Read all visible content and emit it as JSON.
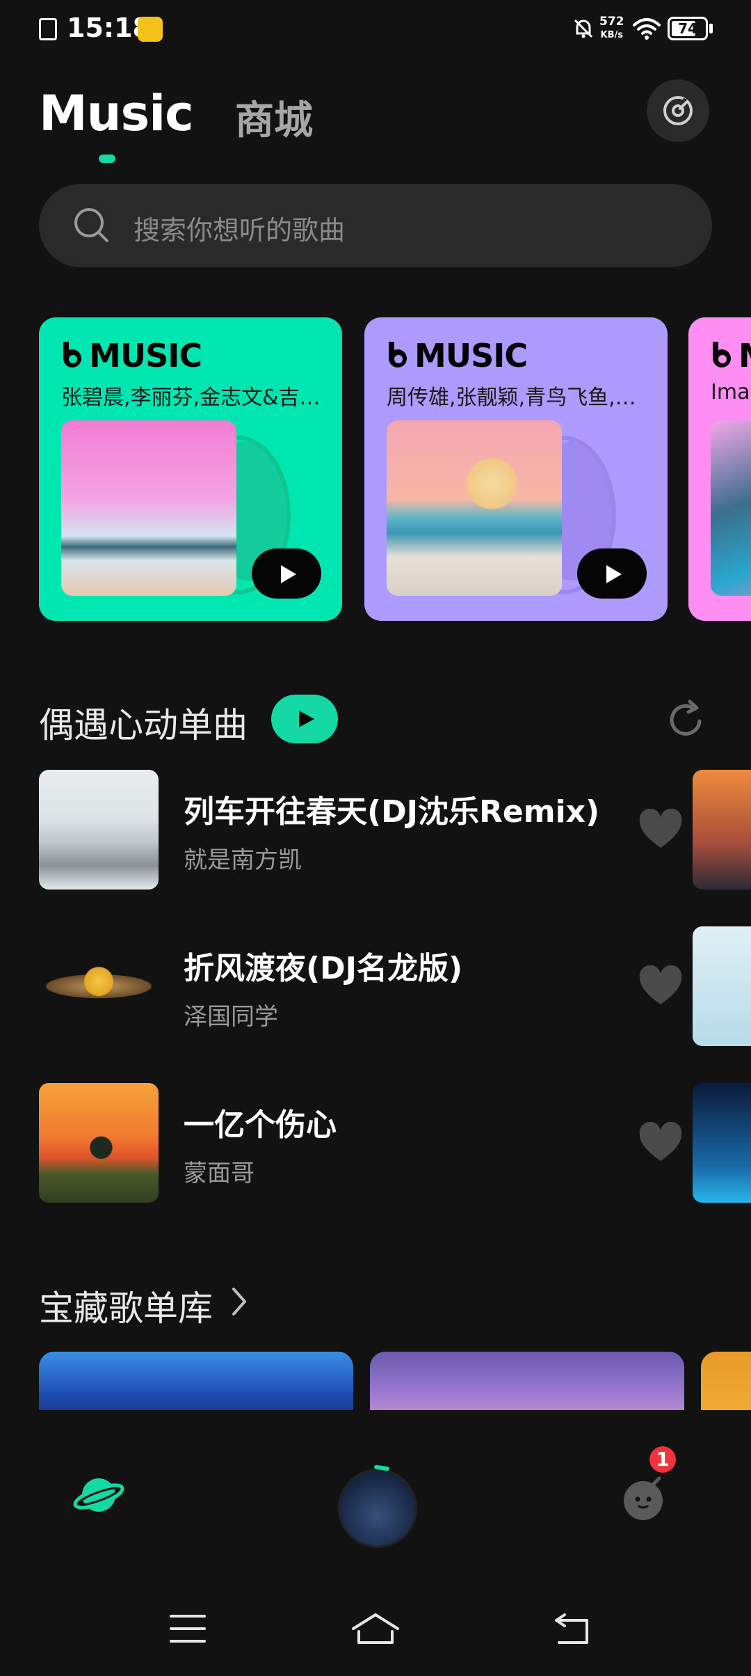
{
  "status_bar": {
    "time": "15:18",
    "net_speed_value": "572",
    "net_speed_unit": "KB/s",
    "battery": "74",
    "battery_level": 0.74
  },
  "header": {
    "tabs": [
      {
        "label": "Music",
        "active": true
      },
      {
        "label": "商城",
        "active": false
      }
    ],
    "settings_icon": "disc-settings-icon",
    "accent_color": "#14d9a4"
  },
  "search": {
    "placeholder": "搜索你想听的歌曲"
  },
  "banners": [
    {
      "logo": "MUSIC",
      "artists": "张碧晨,李丽芬,金志文&吉…",
      "color": "#00e6b0"
    },
    {
      "logo": "MUSIC",
      "artists": "周传雄,张靓颖,青鸟飞鱼,魏…",
      "color": "#ad9bff"
    },
    {
      "logo": "MU",
      "artists": "Imag",
      "color": "#ff8ef2"
    }
  ],
  "single_songs": {
    "title": "偶遇心动单曲",
    "songs": [
      {
        "title": "列车开往春天(DJ沈乐Remix)",
        "artist": "就是南方凯"
      },
      {
        "title": "折风渡夜(DJ名龙版)",
        "artist": "泽国同学"
      },
      {
        "title": "一亿个伤心",
        "artist": "蒙面哥"
      }
    ]
  },
  "playlist_library": {
    "title": "宝藏歌单库"
  },
  "bottom_nav": {
    "items": [
      "discover-planet-icon",
      "now-playing-disc",
      "profile-icon"
    ],
    "profile_badge": "1"
  }
}
